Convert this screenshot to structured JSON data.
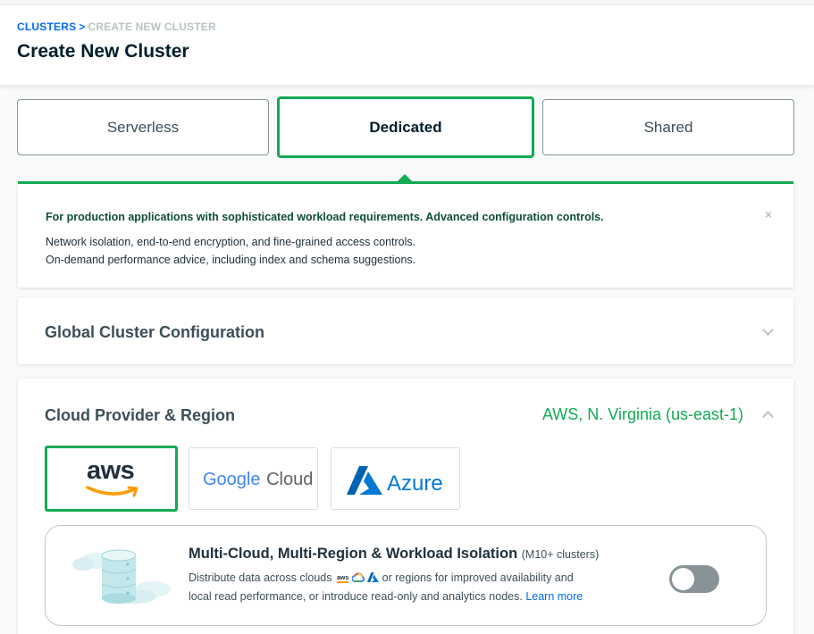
{
  "breadcrumb": {
    "clusters": "CLUSTERS",
    "separator": ">",
    "current": "CREATE NEW CLUSTER"
  },
  "page_title": "Create New Cluster",
  "tiers": [
    {
      "label": "Serverless",
      "selected": false
    },
    {
      "label": "Dedicated",
      "selected": true
    },
    {
      "label": "Shared",
      "selected": false
    }
  ],
  "info": {
    "title": "For production applications with sophisticated workload requirements. Advanced configuration controls.",
    "line1": "Network isolation, end-to-end encryption, and fine-grained access controls.",
    "line2": "On-demand performance advice, including index and schema suggestions.",
    "close": "×"
  },
  "global_config": {
    "title": "Global Cluster Configuration"
  },
  "cloud": {
    "title": "Cloud Provider & Region",
    "summary": "AWS, N. Virginia (us-east-1)",
    "providers": {
      "aws": "aws",
      "google_a": "Google",
      "google_b": "Cloud",
      "azure": "Azure"
    },
    "multicloud": {
      "title": "Multi-Cloud, Multi-Region & Workload Isolation",
      "title_sub": "(M10+ clusters)",
      "desc1_a": "Distribute data across clouds",
      "desc1_aws": "aws",
      "desc1_b": "or regions for improved availability and",
      "desc2": "local read performance, or introduce read-only and analytics nodes.",
      "learn_more": "Learn more",
      "enabled": false
    }
  },
  "colors": {
    "accent": "#13aa52",
    "link": "#016bf8",
    "aws_orange": "#ff9900",
    "azure_blue": "#0078d4"
  }
}
